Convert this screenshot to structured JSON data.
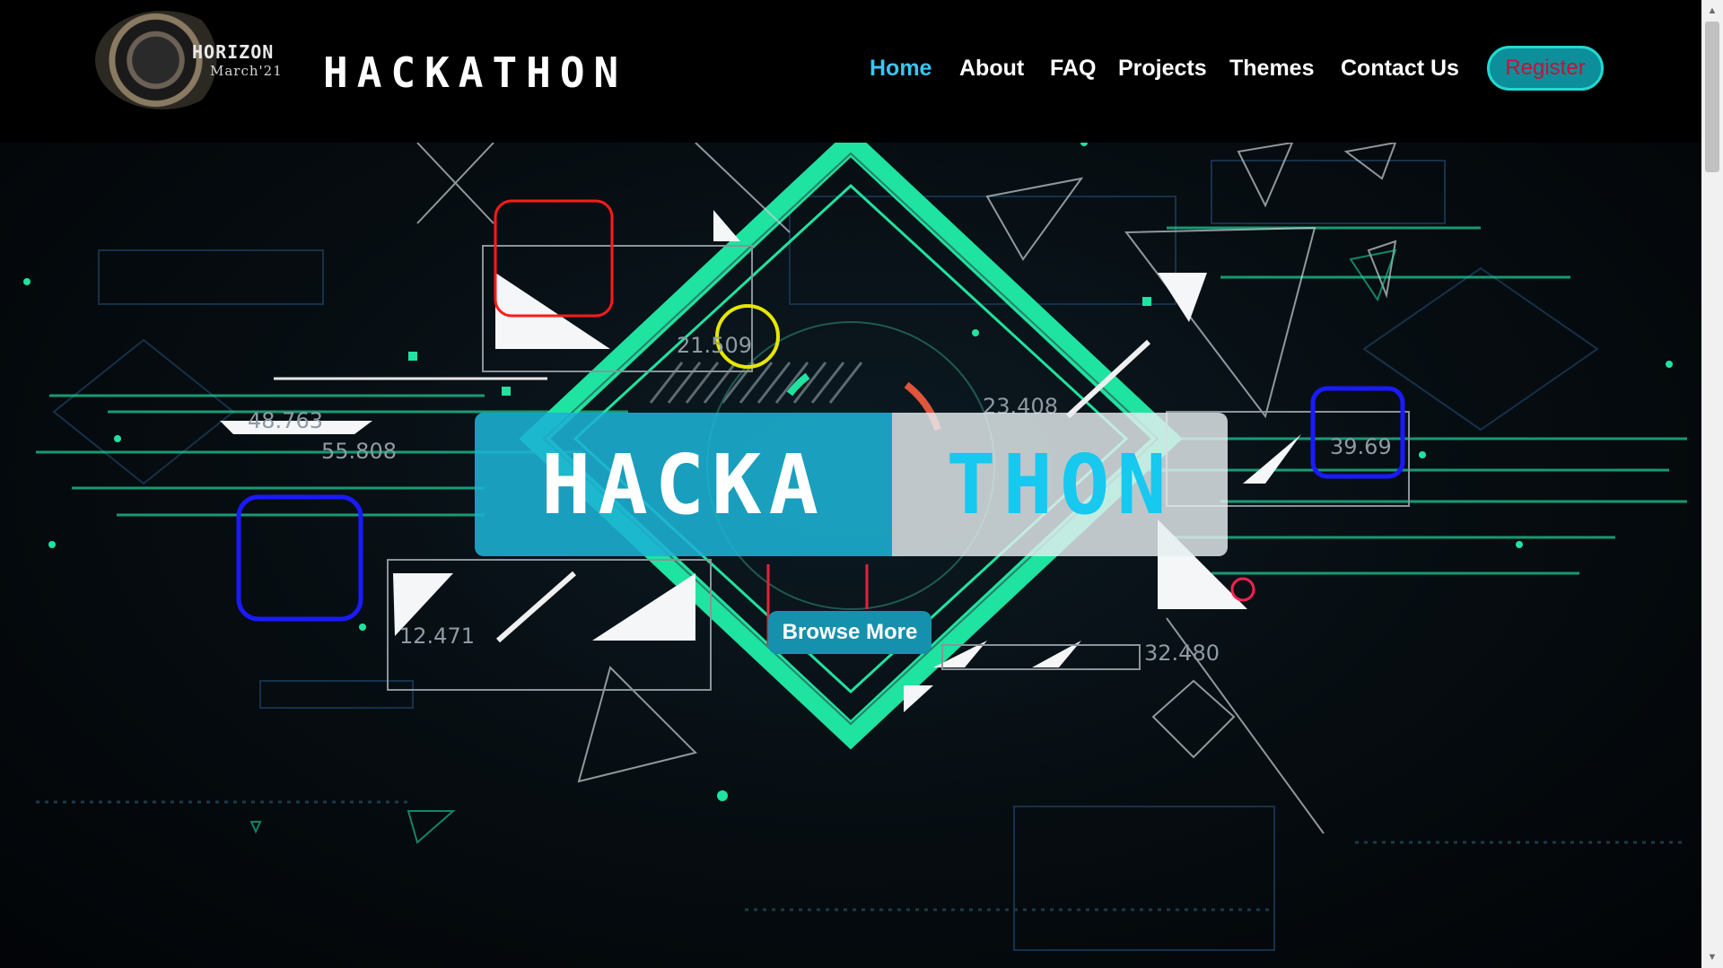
{
  "logo": {
    "line1": "HORIZON",
    "line2": "March'21"
  },
  "brand": "HACKATHON",
  "nav": {
    "items": [
      "Home",
      "About",
      "FAQ",
      "Projects",
      "Themes",
      "Contact Us"
    ],
    "active": "Home",
    "register": "Register"
  },
  "hero": {
    "title_left": "HACKA",
    "title_right": "THON",
    "button": "Browse More",
    "numbers": [
      "21.509",
      "48.763",
      "55.808",
      "23.408",
      "39.69",
      "12.471",
      "32.480"
    ]
  },
  "colors": {
    "accent_cyan": "#38c6f4",
    "accent_green": "#1fe3a0",
    "register_text": "#c4123a",
    "title_box_left": "#1db2d4",
    "button_bg": "#1691ad"
  }
}
